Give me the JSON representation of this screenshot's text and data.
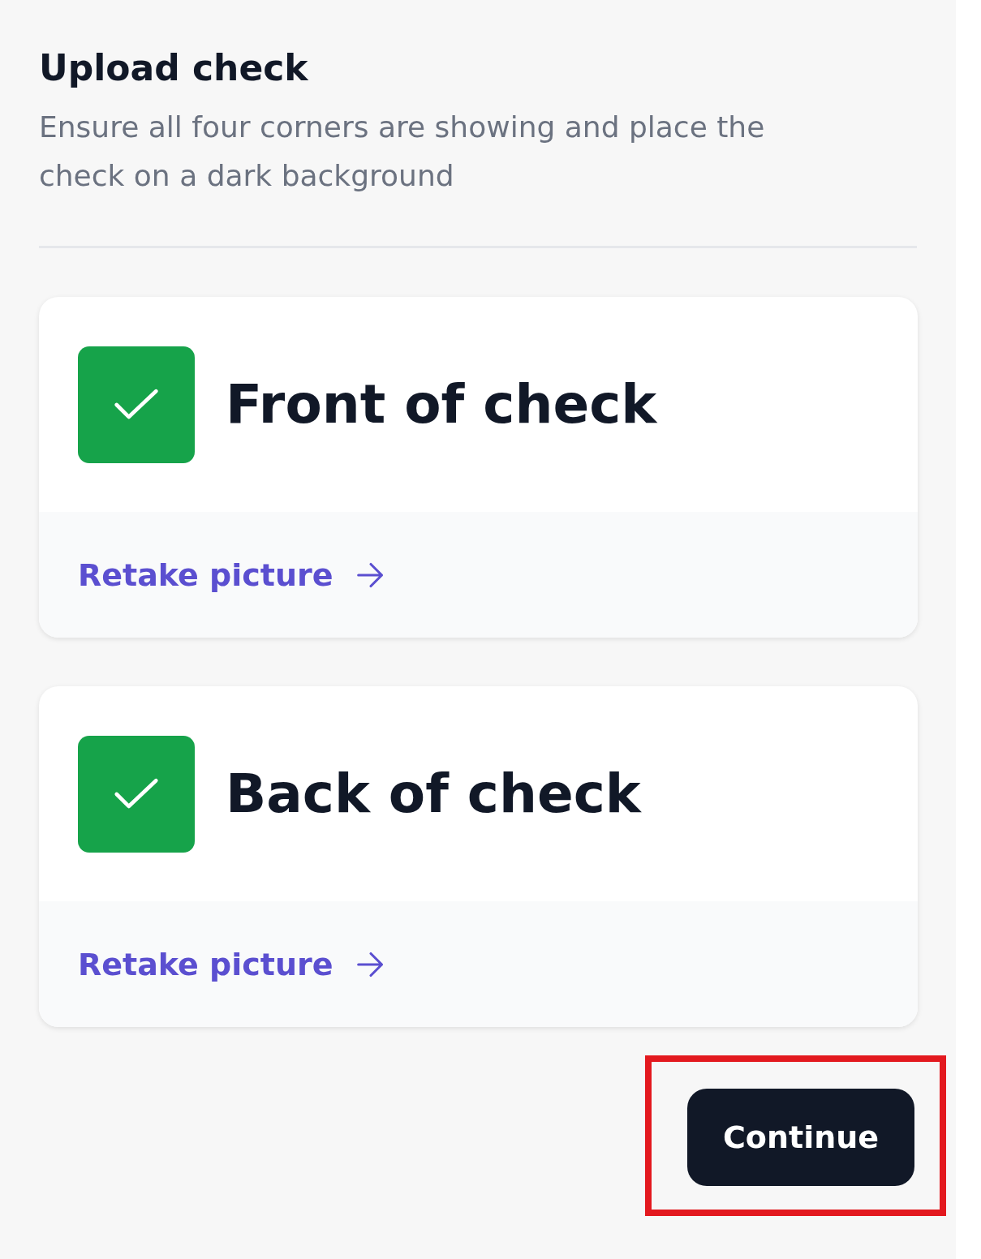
{
  "title": "Upload check",
  "subtitle": "Ensure all four corners are showing and place the check on a dark background",
  "cards": [
    {
      "title": "Front of check",
      "done": true,
      "link": "Retake picture"
    },
    {
      "title": "Back of check",
      "done": true,
      "link": "Retake picture"
    }
  ],
  "continue_button": {
    "label": "Continue",
    "highlighted": true
  }
}
